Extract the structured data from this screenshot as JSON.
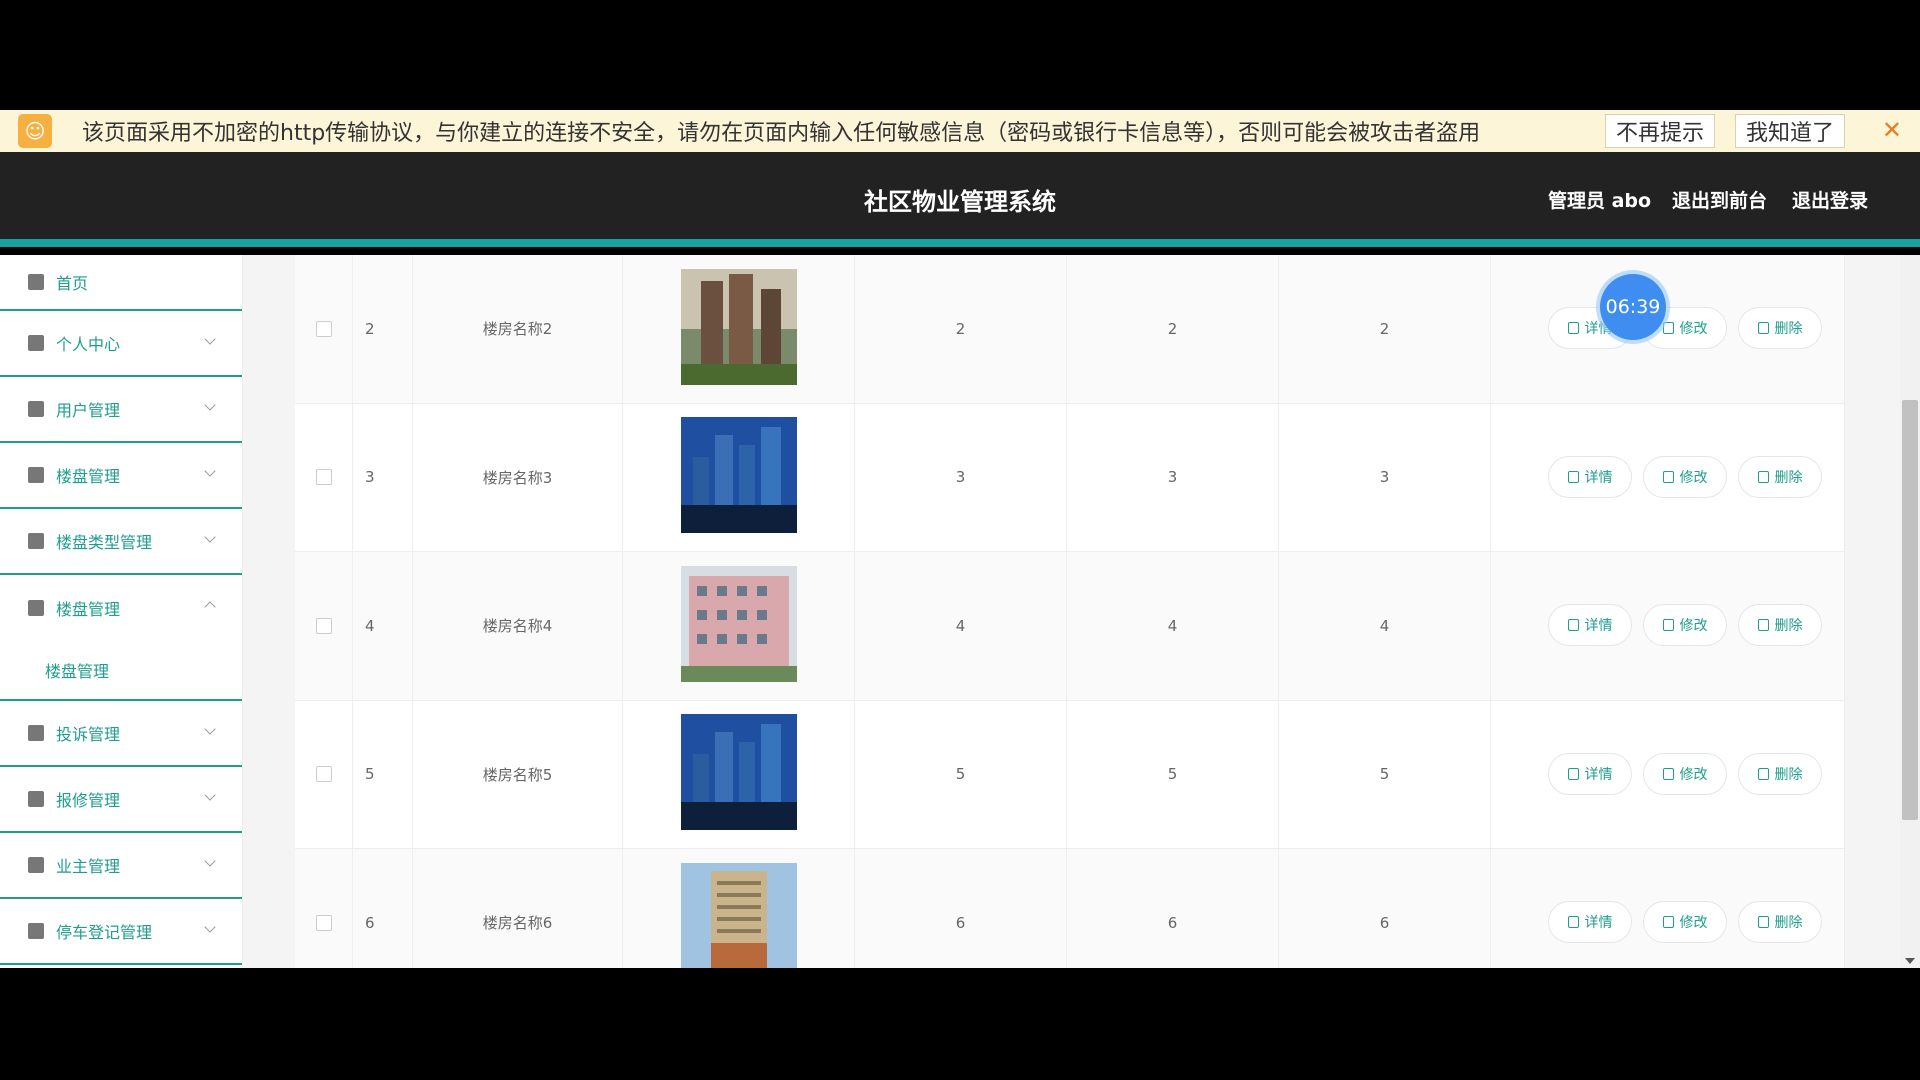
{
  "banner": {
    "text": "该页面采用不加密的http传输协议，与你建立的连接不安全，请勿在页面内输入任何敏感信息（密码或银行卡信息等），否则可能会被攻击者盗用",
    "dont_remind": "不再提示",
    "got_it": "我知道了",
    "close": "✕"
  },
  "header": {
    "title": "社区物业管理系统",
    "admin": "管理员 abo",
    "to_front": "退出到前台",
    "logout": "退出登录"
  },
  "sidebar": {
    "items": [
      {
        "label": "首页",
        "icon": "home-icon"
      },
      {
        "label": "个人中心",
        "icon": "user-icon"
      },
      {
        "label": "用户管理",
        "icon": "clipboard-icon"
      },
      {
        "label": "楼盘管理",
        "icon": "briefcase-icon"
      },
      {
        "label": "楼盘类型管理",
        "icon": "book-icon"
      },
      {
        "label": "楼盘管理",
        "icon": "checklist-icon"
      },
      {
        "label": "投诉管理",
        "icon": "bar-chart-icon"
      },
      {
        "label": "报修管理",
        "icon": "message-icon"
      },
      {
        "label": "业主管理",
        "icon": "grid-icon"
      },
      {
        "label": "停车登记管理",
        "icon": "chat-icon"
      }
    ],
    "sub_item": "楼盘管理"
  },
  "table": {
    "rows": [
      {
        "index": "2",
        "name": "楼房名称2",
        "c1": "2",
        "c2": "2",
        "c3": "2",
        "img": "sky1"
      },
      {
        "index": "3",
        "name": "楼房名称3",
        "c1": "3",
        "c2": "3",
        "c3": "3",
        "img": "sky2"
      },
      {
        "index": "4",
        "name": "楼房名称4",
        "c1": "4",
        "c2": "4",
        "c3": "4",
        "img": "pink"
      },
      {
        "index": "5",
        "name": "楼房名称5",
        "c1": "5",
        "c2": "5",
        "c3": "5",
        "img": "sky2"
      },
      {
        "index": "6",
        "name": "楼房名称6",
        "c1": "6",
        "c2": "6",
        "c3": "6",
        "img": "tower"
      }
    ],
    "actions": {
      "detail": "详情",
      "edit": "修改",
      "delete": "删除"
    }
  },
  "timer": "06:39",
  "colors": {
    "accent": "#1f9e8c",
    "header_bg": "#222222",
    "banner_bg": "#fdf5d8",
    "timer": "#3f8df0"
  }
}
